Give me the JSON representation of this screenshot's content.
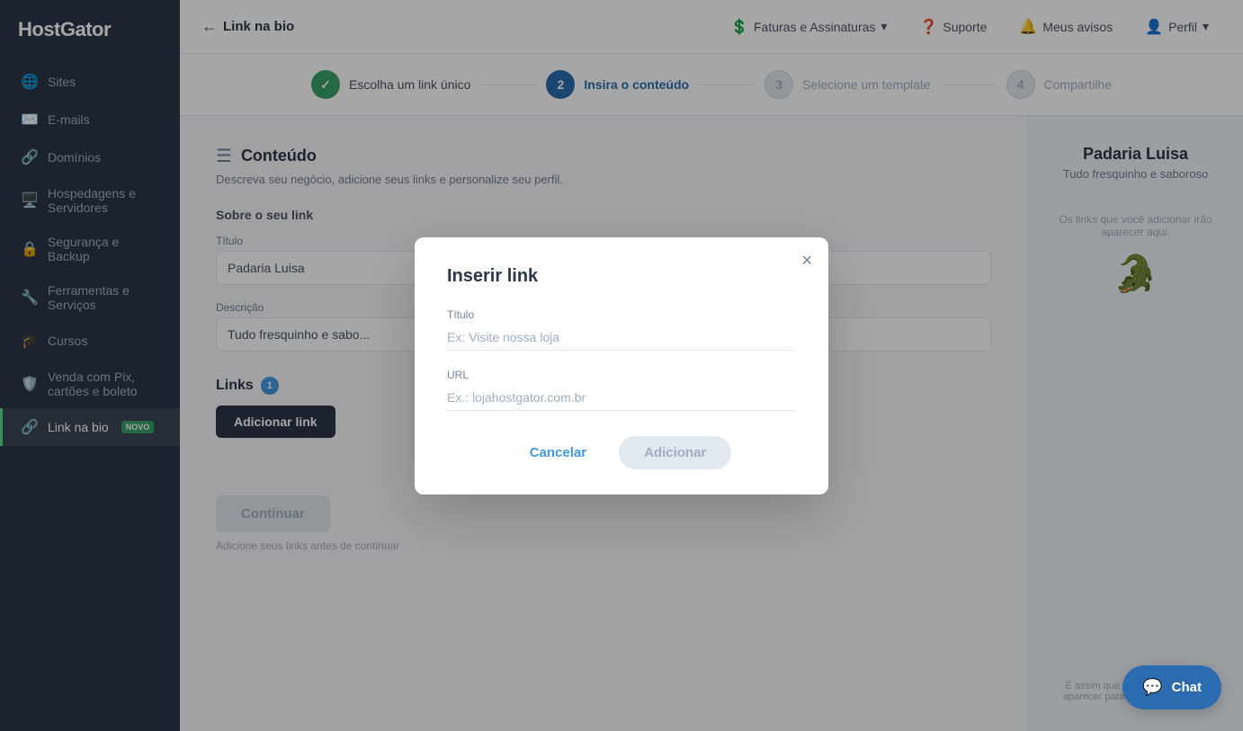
{
  "sidebar": {
    "logo": "HostGator",
    "items": [
      {
        "id": "sites",
        "label": "Sites",
        "icon": "🌐",
        "active": false
      },
      {
        "id": "emails",
        "label": "E-mails",
        "icon": "✉️",
        "active": false
      },
      {
        "id": "dominios",
        "label": "Domínios",
        "icon": "🔗",
        "active": false
      },
      {
        "id": "hospedagens",
        "label": "Hospedagens e Servidores",
        "icon": "🖥️",
        "active": false
      },
      {
        "id": "seguranca",
        "label": "Segurança e Backup",
        "icon": "🔒",
        "active": false
      },
      {
        "id": "ferramentas",
        "label": "Ferramentas e Serviços",
        "icon": "🔧",
        "active": false
      },
      {
        "id": "cursos",
        "label": "Cursos",
        "icon": "🎓",
        "active": false
      },
      {
        "id": "venda-pix",
        "label": "Venda com Pix, cartões e boleto",
        "icon": "🛡️",
        "active": false
      },
      {
        "id": "link-bio",
        "label": "Link na bio",
        "icon": "🔗",
        "active": true,
        "badge": "NOVO"
      }
    ]
  },
  "topnav": {
    "back_arrow": "←",
    "page_title": "Link na bio",
    "faturas_label": "Faturas e Assinaturas",
    "suporte_label": "Suporte",
    "avisos_label": "Meus avisos",
    "perfil_label": "Perfil"
  },
  "steps": [
    {
      "number": "✓",
      "label": "Escolha um link único",
      "state": "done"
    },
    {
      "number": "2",
      "label": "Insira o conteúdo",
      "state": "active"
    },
    {
      "number": "3",
      "label": "Selecione um template",
      "state": "inactive"
    },
    {
      "number": "4",
      "label": "Compartilhe",
      "state": "inactive"
    }
  ],
  "form": {
    "section_title": "Conteúdo",
    "section_desc": "Descreva seu negócio, adicione seus links e personalize seu perfil.",
    "link_section_title": "Sobre o seu link",
    "title_label": "Título",
    "title_value": "Padaria Luisa",
    "description_label": "Descrição",
    "description_value": "Tudo fresquinho e sabo...",
    "links_label": "Links",
    "links_count": "1",
    "add_link_btn": "Adicionar link",
    "continue_btn": "Continuar",
    "hint_text": "Adicione seus links antes de continuar"
  },
  "preview": {
    "business_name": "Padaria Luisa",
    "business_sub": "Tudo fresquinho e saboroso",
    "empty_links_text": "Os links que você adicionar irão aparecer aqui.",
    "footer_text": "É assim que seu Link na Bio vai aparecer para os seus visitantes."
  },
  "modal": {
    "title": "Inserir link",
    "close_icon": "×",
    "title_label": "Título",
    "title_placeholder": "Ex: Visite nossa loja",
    "url_label": "URL",
    "url_placeholder": "Ex.: lojahostgator.com.br",
    "cancel_btn": "Cancelar",
    "add_btn": "Adicionar"
  },
  "chat": {
    "label": "Chat"
  }
}
